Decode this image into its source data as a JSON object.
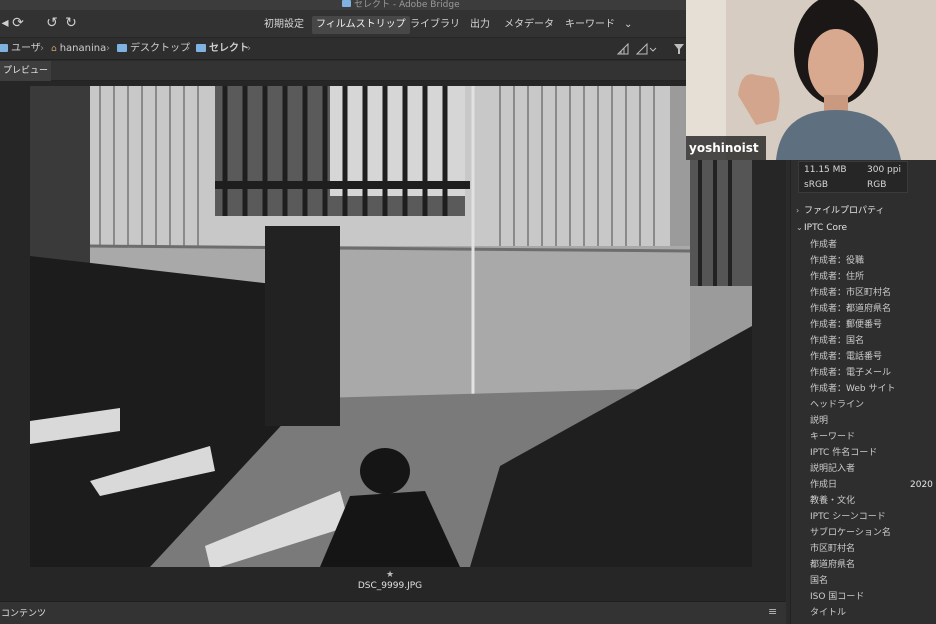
{
  "window": {
    "title": "セレクト - Adobe Bridge"
  },
  "toolbar": {
    "workspaces": [
      "初期設定",
      "フィルムストリップ",
      "ライブラリ",
      "出力",
      "メタデータ",
      "キーワード"
    ],
    "active_workspace": "フィルムストリップ"
  },
  "path": {
    "crumbs": [
      "ユーザ",
      "hananina",
      "デスクトップ",
      "セレクト"
    ]
  },
  "preview": {
    "tab_label": "プレビュー",
    "filename": "DSC_9999.JPG",
    "rating_star": "★"
  },
  "content_panel": {
    "label": "コンテンツ"
  },
  "metadata": {
    "file_size": "11.15 MB",
    "resolution": "300 ppi",
    "color_profile": "sRGB",
    "color_mode": "RGB",
    "sections": [
      {
        "label": "ファイルプロパティ",
        "expanded": false
      },
      {
        "label": "IPTC Core",
        "expanded": true
      }
    ],
    "fields": [
      {
        "label": "作成者",
        "value": ""
      },
      {
        "label": "作成者：役職",
        "value": ""
      },
      {
        "label": "作成者：住所",
        "value": ""
      },
      {
        "label": "作成者：市区町村名",
        "value": ""
      },
      {
        "label": "作成者：都道府県名",
        "value": ""
      },
      {
        "label": "作成者：郵便番号",
        "value": ""
      },
      {
        "label": "作成者：国名",
        "value": ""
      },
      {
        "label": "作成者：電話番号",
        "value": ""
      },
      {
        "label": "作成者：電子メール",
        "value": ""
      },
      {
        "label": "作成者：Web サイト",
        "value": ""
      },
      {
        "label": "ヘッドライン",
        "value": ""
      },
      {
        "label": "説明",
        "value": ""
      },
      {
        "label": "キーワード",
        "value": ""
      },
      {
        "label": "IPTC 件名コード",
        "value": ""
      },
      {
        "label": "説明記入者",
        "value": ""
      },
      {
        "label": "作成日",
        "value": "2020"
      },
      {
        "label": "教養・文化",
        "value": ""
      },
      {
        "label": "IPTC シーンコード",
        "value": ""
      },
      {
        "label": "サブロケーション名",
        "value": ""
      },
      {
        "label": "市区町村名",
        "value": ""
      },
      {
        "label": "都道府県名",
        "value": ""
      },
      {
        "label": "国名",
        "value": ""
      },
      {
        "label": "ISO 国コード",
        "value": ""
      },
      {
        "label": "タイトル",
        "value": ""
      }
    ]
  },
  "webcam": {
    "name": "yoshinoist"
  }
}
